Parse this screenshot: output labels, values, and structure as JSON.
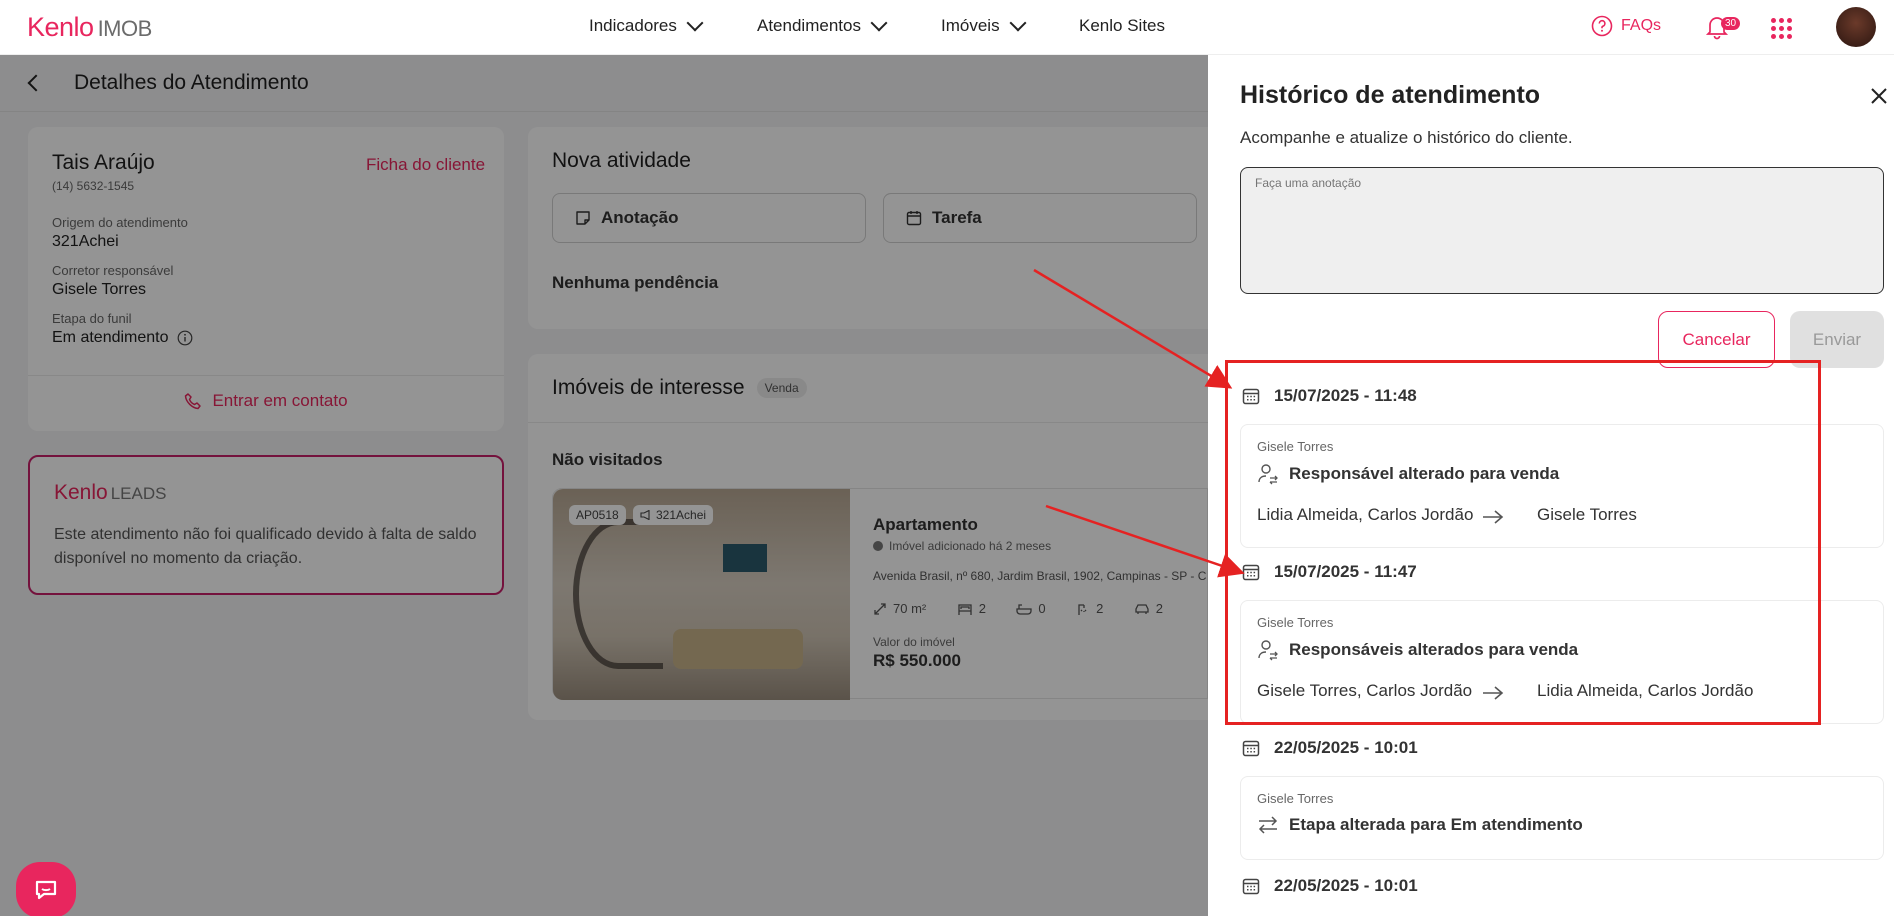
{
  "brand": {
    "name_main": "Kenlo",
    "name_sub": "IMOB"
  },
  "nav": {
    "items": [
      "Indicadores",
      "Atendimentos",
      "Imóveis",
      "Kenlo Sites"
    ]
  },
  "header": {
    "faqs": "FAQs",
    "notifications": "30"
  },
  "page": {
    "title": "Detalhes do Atendimento"
  },
  "client": {
    "name": "Tais Araújo",
    "phone": "(14) 5632-1545",
    "ficha_link": "Ficha do cliente",
    "origin_label": "Origem do atendimento",
    "origin": "321Achei",
    "broker_label": "Corretor responsável",
    "broker": "Gisele Torres",
    "stage_label": "Etapa do funil",
    "stage": "Em atendimento",
    "contact_button": "Entrar em contato"
  },
  "leads": {
    "brand_main": "Kenlo",
    "brand_sub": "LEADS",
    "message": "Este atendimento não foi qualificado devido à falta de saldo disponível no momento da criação."
  },
  "activity": {
    "title": "Nova atividade",
    "note_button": "Anotação",
    "task_button": "Tarefa",
    "empty": "Nenhuma pendência"
  },
  "interest": {
    "title": "Imóveis de interesse",
    "badge": "Venda",
    "section": "Não visitados",
    "property": {
      "code": "AP0518",
      "source": "321Achei",
      "type": "Apartamento",
      "added": "Imóvel adicionado há 2 meses",
      "address": "Avenida Brasil, nº 680, Jardim Brasil, 1902, Campinas - SP - C",
      "area": "70 m²",
      "bedrooms": "2",
      "suites": "0",
      "bathrooms": "2",
      "parking": "2",
      "price_label": "Valor do imóvel",
      "price": "R$ 550.000"
    }
  },
  "history": {
    "title": "Histórico de atendimento",
    "subtitle": "Acompanhe e atualize o histórico do cliente.",
    "placeholder": "Faça uma anotação",
    "cancel": "Cancelar",
    "send": "Enviar",
    "entries": [
      {
        "date": "15/07/2025 - 11:48",
        "author": "Gisele Torres",
        "action": "Responsável alterado para venda",
        "from": "Lidia Almeida, Carlos Jordão",
        "to": "Gisele Torres"
      },
      {
        "date": "15/07/2025 - 11:47",
        "author": "Gisele Torres",
        "action": "Responsáveis alterados para venda",
        "from": "Gisele Torres, Carlos Jordão",
        "to": "Lidia Almeida, Carlos Jordão"
      },
      {
        "date": "22/05/2025 - 10:01",
        "author": "Gisele Torres",
        "action": "Etapa alterada para Em atendimento"
      },
      {
        "date": "22/05/2025 - 10:01"
      }
    ]
  },
  "colors": {
    "accent": "#e8265e",
    "annotation": "#e52222"
  }
}
